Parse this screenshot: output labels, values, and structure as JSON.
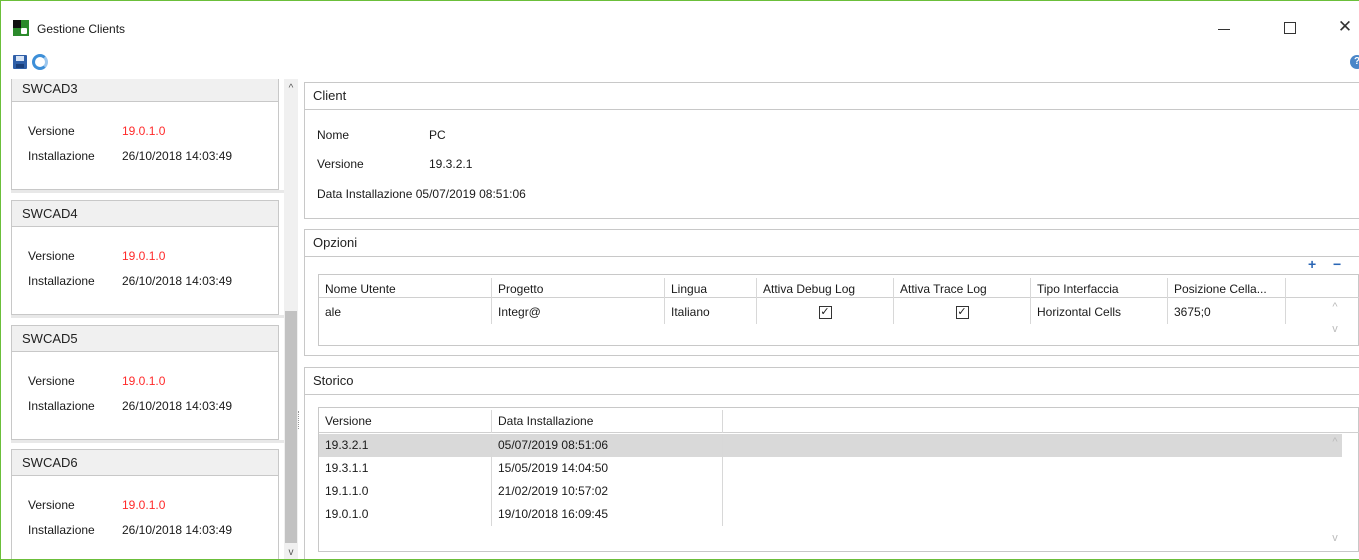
{
  "window": {
    "title": "Gestione Clients"
  },
  "left_panel": {
    "cards": [
      {
        "name": "SWCAD3",
        "versione_label": "Versione",
        "versione": "19.0.1.0",
        "installazione_label": "Installazione",
        "installazione": "26/10/2018 14:03:49"
      },
      {
        "name": "SWCAD4",
        "versione_label": "Versione",
        "versione": "19.0.1.0",
        "installazione_label": "Installazione",
        "installazione": "26/10/2018 14:03:49"
      },
      {
        "name": "SWCAD5",
        "versione_label": "Versione",
        "versione": "19.0.1.0",
        "installazione_label": "Installazione",
        "installazione": "26/10/2018 14:03:49"
      },
      {
        "name": "SWCAD6",
        "versione_label": "Versione",
        "versione": "19.0.1.0",
        "installazione_label": "Installazione",
        "installazione": "26/10/2018 14:03:49"
      }
    ]
  },
  "client": {
    "header": "Client",
    "nome_label": "Nome",
    "nome": "PC",
    "versione_label": "Versione",
    "versione": "19.3.2.1",
    "data_label": "Data Installazione",
    "data": "05/07/2019 08:51:06"
  },
  "opzioni": {
    "header": "Opzioni",
    "columns": [
      "Nome Utente",
      "Progetto",
      "Lingua",
      "Attiva Debug Log",
      "Attiva Trace Log",
      "Tipo Interfaccia",
      "Posizione Cella..."
    ],
    "rows": [
      {
        "nome_utente": "ale",
        "progetto": "Integr@",
        "lingua": "Italiano",
        "debug": true,
        "trace": true,
        "tipo": "Horizontal Cells",
        "posizione": "3675;0"
      }
    ],
    "check_glyph": "✓"
  },
  "storico": {
    "header": "Storico",
    "columns": [
      "Versione",
      "Data Installazione"
    ],
    "rows": [
      {
        "versione": "19.3.2.1",
        "data": "05/07/2019 08:51:06"
      },
      {
        "versione": "19.3.1.1",
        "data": "15/05/2019 14:04:50"
      },
      {
        "versione": "19.1.1.0",
        "data": "21/02/2019 10:57:02"
      },
      {
        "versione": "19.0.1.0",
        "data": "19/10/2018 16:09:45"
      }
    ]
  },
  "icons": {
    "close": "✕",
    "plus": "+",
    "minus": "−",
    "help": "?",
    "scroll_up": "^",
    "scroll_down": "v"
  }
}
